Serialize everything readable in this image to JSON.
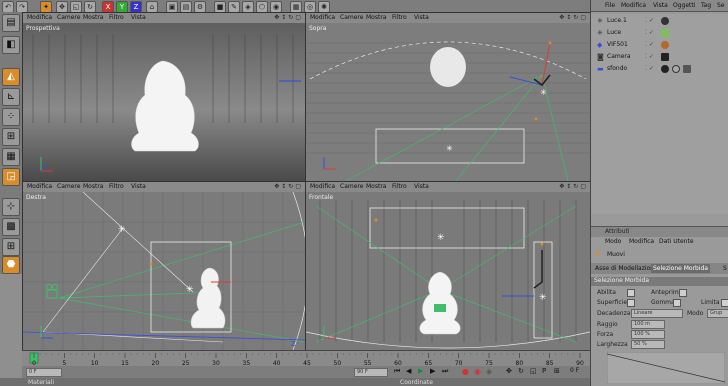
{
  "viewport_menu": [
    "Modifica",
    "Camere",
    "Mostra",
    "Filtro",
    "Vista"
  ],
  "viewports": {
    "top_left": {
      "label": "Prospettiva"
    },
    "top_right": {
      "label": "Sopra"
    },
    "bottom_left": {
      "label": "Destra"
    },
    "bottom_right": {
      "label": "Frontale"
    }
  },
  "right_menu": [
    "File",
    "Modifica",
    "Vista",
    "Oggetti",
    "Tag",
    "Se"
  ],
  "objects": [
    {
      "name": "Luce.1"
    },
    {
      "name": "Luce"
    },
    {
      "name": "VIF501"
    },
    {
      "name": "Camera"
    },
    {
      "name": "sfondo"
    }
  ],
  "attributes": {
    "title": "Attributi",
    "menu": [
      "Modo",
      "Modifica",
      "Dati Utente"
    ],
    "tool_name": "Muovi",
    "tabs": [
      "Asse di Modellazione",
      "Selezione Morbida",
      "S"
    ],
    "section": "Selezione Morbida",
    "rows": [
      {
        "label": "Abilita",
        "right_label": "Anteprima"
      },
      {
        "label": "Superficie",
        "right_label": "Gomma",
        "far_label": "Limita"
      },
      {
        "label": "Decadenza",
        "value": "Lineare",
        "right_label": "Modo",
        "right_value": "Grup"
      },
      {
        "label": "Raggio",
        "value": "100 m"
      },
      {
        "label": "Forza",
        "value": "100 %"
      },
      {
        "label": "Larghezza",
        "value": "50 %"
      }
    ]
  },
  "timeline": {
    "ticks": [
      "0",
      "5",
      "10",
      "15",
      "20",
      "25",
      "30",
      "35",
      "40",
      "45",
      "50",
      "55",
      "60",
      "65",
      "70",
      "75",
      "80",
      "85",
      "90"
    ],
    "start_field": "0 F",
    "end_field": "90 F",
    "frame_label": "0 F"
  },
  "bottom": {
    "left_label": "Materiali",
    "right_label": "Coordinate"
  },
  "colors": {
    "accent": "#d98c2a",
    "viewport_bg": "#7a7a7a",
    "grid_line": "#666666",
    "guide_green": "#3fbf6a",
    "axis_red": "#d83a3a",
    "axis_blue": "#3a4fd8"
  }
}
